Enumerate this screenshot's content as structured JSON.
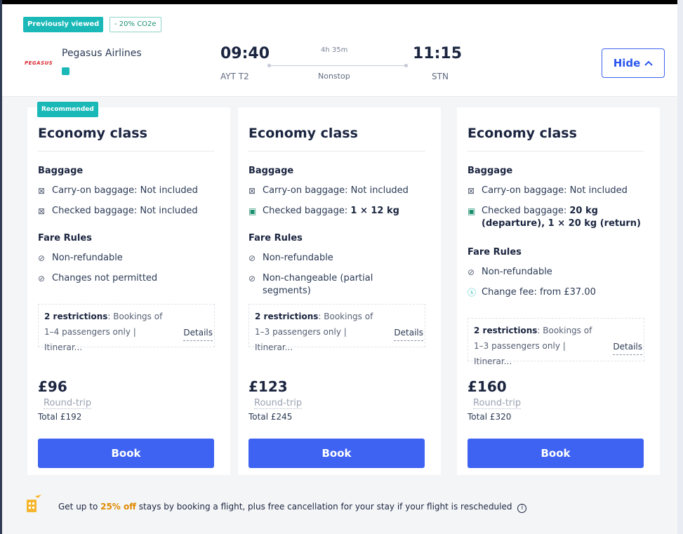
{
  "header": {
    "badge_previously_viewed": "Previously viewed",
    "badge_co2": "- 20% CO2e",
    "airline_logo_text": "PEGASUS",
    "airline_name": "Pegasus Airlines",
    "departure_time": "09:40",
    "departure_airport": "AYT T2",
    "duration": "4h 35m",
    "stops": "Nonstop",
    "arrival_time": "11:15",
    "arrival_airport": "STN",
    "hide_label": "Hide",
    "hide_icon": "chevron-up-icon"
  },
  "labels": {
    "baggage": "Baggage",
    "fare_rules": "Fare Rules",
    "details": "Details",
    "round_trip": "Round-trip",
    "book": "Book",
    "recommended": "Recommended"
  },
  "cards": [
    {
      "title": "Economy class",
      "carry_on": "Carry-on baggage: Not included",
      "checked_prefix": "Checked baggage: Not included",
      "checked_value": "",
      "rule_1": "Non-refundable",
      "rule_2": "Changes not permitted",
      "restrictions_label": "2 restrictions",
      "restrictions_text": ": Bookings of 1–4 passengers only | Itinerar...",
      "price": "£96",
      "total": "Total £192"
    },
    {
      "title": "Economy class",
      "carry_on": "Carry-on baggage: Not included",
      "checked_prefix": "Checked baggage: ",
      "checked_value": "1 × 12 kg",
      "rule_1": "Non-refundable",
      "rule_2": "Non-changeable (partial segments)",
      "restrictions_label": "2 restrictions",
      "restrictions_text": ": Bookings of 1–3 passengers only | Itinerar...",
      "price": "£123",
      "total": "Total £245"
    },
    {
      "title": "Economy class",
      "carry_on": "Carry-on baggage: Not included",
      "checked_prefix": "Checked baggage: ",
      "checked_value": "20 kg (departure), 1 × 20 kg (return)",
      "rule_1": "Non-refundable",
      "rule_2": "Change fee: from £37.00",
      "restrictions_label": "2 restrictions",
      "restrictions_text": ": Bookings of 1–3 passengers only | Itinerar...",
      "price": "£160",
      "total": "Total £320"
    }
  ],
  "promo": {
    "text_before": "Get up to ",
    "highlight": "25% off",
    "text_after": " stays by booking a flight, plus free cancellation for your stay if your flight is rescheduled",
    "info_icon": "info-icon"
  },
  "colors": {
    "primary_button": "#3e63f2",
    "teal_badge": "#1bb8b8",
    "promo_highlight": "#e08a00"
  }
}
